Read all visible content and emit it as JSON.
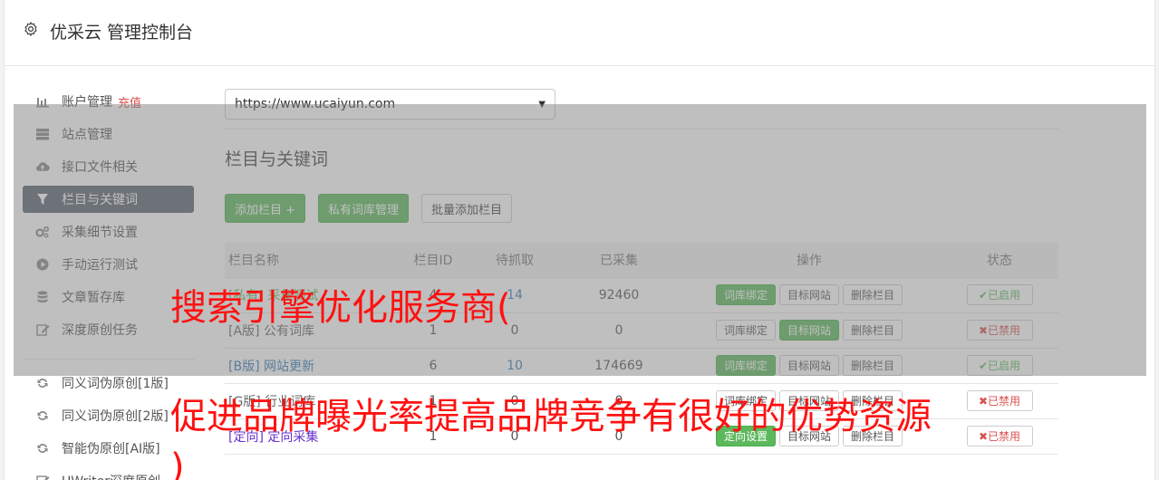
{
  "header": {
    "title": "优采云 管理控制台",
    "icon": "gear-icon"
  },
  "sidebar": {
    "items": [
      {
        "label": "账户管理",
        "extra": "充值",
        "icon": "bar-chart-icon"
      },
      {
        "label": "站点管理",
        "icon": "server-icon"
      },
      {
        "label": "接口文件相关",
        "icon": "cloud-upload-icon"
      },
      {
        "label": "栏目与关键词",
        "icon": "filter-icon",
        "active": true
      },
      {
        "label": "采集细节设置",
        "icon": "cogs-icon"
      },
      {
        "label": "手动运行测试",
        "icon": "play-circle-icon"
      },
      {
        "label": "文章暂存库",
        "icon": "database-icon"
      },
      {
        "label": "深度原创任务",
        "icon": "edit-icon"
      },
      {
        "label": "同义词伪原创[1版]",
        "icon": "refresh-icon"
      },
      {
        "label": "同义词伪原创[2版]",
        "icon": "refresh-icon"
      },
      {
        "label": "智能伪原创[AI版]",
        "icon": "refresh-icon"
      },
      {
        "label": "UWriter深度原创",
        "icon": "edit-icon"
      }
    ]
  },
  "main": {
    "site_select": "https://www.ucaiyun.com",
    "section_title": "栏目与关键词",
    "buttons": {
      "add_column": "添加栏目 +",
      "private_lib": "私有词库管理",
      "batch_add": "批量添加栏目"
    },
    "table": {
      "headers": [
        "栏目名称",
        "栏目ID",
        "待抓取",
        "已采集",
        "操作",
        "状态"
      ],
      "op_labels": {
        "bind": "词库绑定",
        "target": "目标网站",
        "delete": "删除栏目",
        "directed": "定向设置"
      },
      "rows": [
        {
          "name": "[私有] 采集测试",
          "id": "4",
          "pending": "14",
          "collected": "92460",
          "status": "✔已启用"
        },
        {
          "name": "[A版] 公有词库",
          "id": "1",
          "pending": "0",
          "collected": "0",
          "status": "✖已禁用"
        },
        {
          "name": "[B版] 网站更新",
          "id": "6",
          "pending": "10",
          "collected": "174669",
          "status": "✔已启用"
        },
        {
          "name": "[G版] 行业词库",
          "id": "1",
          "pending": "0",
          "collected": "0",
          "status": "✖已禁用"
        },
        {
          "name": "[定向] 定向采集",
          "id": "1",
          "pending": "0",
          "collected": "0",
          "status": "✖已禁用"
        }
      ]
    }
  },
  "overlay_text": {
    "line1": "搜索引擎优化服务商(",
    "line2": "促进品牌曝光率提高品牌竞争有很好的优势资源",
    "line3": ")"
  },
  "colors": {
    "green": "#5cb85c",
    "red": "#d9534f",
    "active_bg": "#5b6270",
    "ad_red": "#ff1111"
  }
}
